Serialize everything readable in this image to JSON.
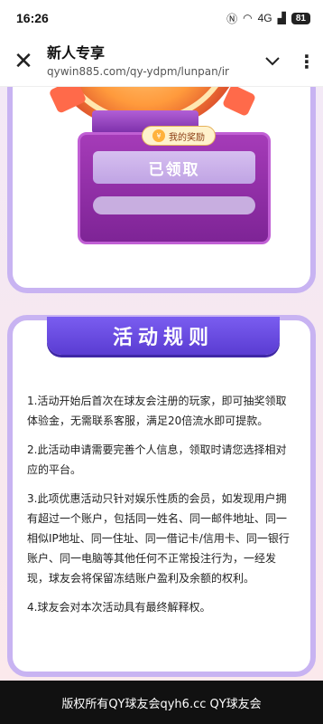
{
  "status_bar": {
    "time": "16:26",
    "signal_text": "4G",
    "battery": "81"
  },
  "browser": {
    "title": "新人专享",
    "url": "qywin885.com/qy-ydpm/lunpan/ir",
    "icons": [
      "close-icon",
      "chevron-down-icon",
      "more-icon"
    ]
  },
  "prize": {
    "tag_label": "我的奖励",
    "claimed_label": "已领取"
  },
  "rules": {
    "title": "活动规则",
    "items": [
      "1.活动开始后首次在球友会注册的玩家，即可抽奖领取体验金，无需联系客服，满足20倍流水即可提款。",
      "2.此活动申请需要完善个人信息，领取时请您选择相对应的平台。",
      "3.此项优惠活动只针对娱乐性质的会员，如发现用户拥有超过一个账户，包括同一姓名、同一邮件地址、同一相似IP地址、同一住址、同一借记卡/信用卡、同一银行账户、同一电脑等其他任何不正常投注行为，一经发现，球友会将保留冻结账户盈利及余额的权利。",
      "4.球友会对本次活动具有最终解释权。"
    ]
  },
  "footer": {
    "text": "版权所有QY球友会qyh6.cc QY球友会"
  },
  "colors": {
    "card_border": "#c8b3f2",
    "banner": "#6a4de2",
    "prize_box": "#9a32b0",
    "footer_bg": "#111111"
  }
}
